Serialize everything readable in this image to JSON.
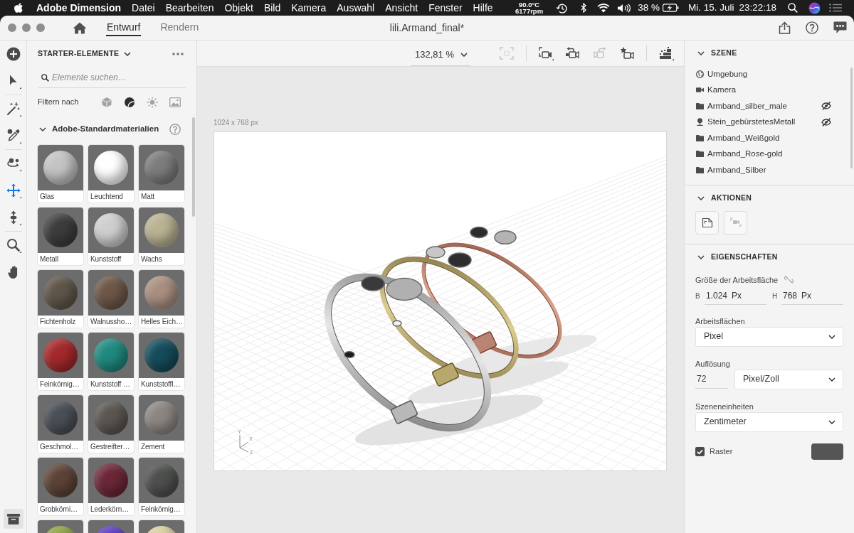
{
  "menubar": {
    "app": "Adobe Dimension",
    "menus": [
      "Datei",
      "Bearbeiten",
      "Objekt",
      "Bild",
      "Kamera",
      "Auswahl",
      "Ansicht",
      "Fenster",
      "Hilfe"
    ],
    "temperature": "90.0°C",
    "fan_speed": "6177rpm",
    "battery": "38 %",
    "date": "Mi. 15. Juli",
    "time": "23:22:18"
  },
  "titlebar": {
    "tabs": [
      {
        "label": "Entwurf",
        "selected": true
      },
      {
        "label": "Rendern",
        "selected": false
      }
    ],
    "title": "lili.Armand_final*"
  },
  "tool_groups": [
    [
      {
        "kind": "select",
        "selected": false
      }
    ],
    [
      {
        "kind": "magic-wand",
        "selected": false
      },
      {
        "kind": "eyedropper",
        "selected": false
      }
    ],
    [
      {
        "kind": "orbit",
        "selected": false
      },
      {
        "kind": "pan",
        "selected": true
      },
      {
        "kind": "dolly",
        "selected": false
      }
    ],
    [
      {
        "kind": "zoom",
        "selected": false
      },
      {
        "kind": "hand",
        "selected": false
      }
    ]
  ],
  "assets_panel": {
    "title": "STARTER-ELEMENTE",
    "search": {
      "placeholder": "Elemente suchen…"
    },
    "filter_label": "Filtern nach",
    "filters": [
      {
        "kind": "models",
        "selected": false
      },
      {
        "kind": "materials",
        "selected": true
      },
      {
        "kind": "lights",
        "selected": false
      },
      {
        "kind": "images",
        "selected": false
      }
    ],
    "section": {
      "title": "Adobe-Standardmaterialien",
      "expanded": true
    },
    "materials": [
      {
        "label": "Glas",
        "color": "#c4c4c4"
      },
      {
        "label": "Leuchtend",
        "color": "#ffffff"
      },
      {
        "label": "Matt",
        "color": "#7c7c7c"
      },
      {
        "label": "Metall",
        "color": "#3c3c3c"
      },
      {
        "label": "Kunststoff",
        "color": "#cfcfcf"
      },
      {
        "label": "Wachs",
        "color": "#b9b293"
      },
      {
        "label": "Fichtenholz",
        "color": "#5f5649"
      },
      {
        "label": "Walnussho…",
        "color": "#6d5747"
      },
      {
        "label": "Helles Eich…",
        "color": "#a98f80"
      },
      {
        "label": "Feinkörnig…",
        "color": "#a3292b"
      },
      {
        "label": "Kunststoff …",
        "color": "#1f8a7f"
      },
      {
        "label": "Kunststoffl…",
        "color": "#154c5c"
      },
      {
        "label": "Geschmol…",
        "color": "#4a4f56"
      },
      {
        "label": "Gestreifter…",
        "color": "#5b5651"
      },
      {
        "label": "Zement",
        "color": "#8b8681"
      },
      {
        "label": "Grobkörni…",
        "color": "#5c4337"
      },
      {
        "label": "Lederkörn…",
        "color": "#6b2737"
      },
      {
        "label": "Feinkörnig…",
        "color": "#4e504e"
      },
      {
        "color": "#8ea243"
      },
      {
        "color": "#5b3cc2"
      },
      {
        "color": "#d9d1a2"
      }
    ]
  },
  "viewport": {
    "zoom": "132,81 %",
    "tool_groups": [
      [
        {
          "kind": "fit",
          "disabled": true
        }
      ],
      [
        {
          "kind": "camera-frame",
          "disabled": false
        },
        {
          "kind": "camera-undo",
          "disabled": false
        },
        {
          "kind": "camera-redo",
          "disabled": true
        },
        {
          "kind": "camera-bookmark",
          "disabled": false
        }
      ],
      [
        {
          "kind": "render-preview",
          "disabled": false
        }
      ]
    ],
    "canvas_size": "1024 x 768 px",
    "axis_labels": {
      "y": "Y",
      "x": "X",
      "z": "Z"
    }
  },
  "scene_panel": {
    "title": "SZENE",
    "expanded": true,
    "items": [
      {
        "label": "Umgebung",
        "kind": "environment",
        "hidden": false
      },
      {
        "label": "Kamera",
        "kind": "camera",
        "hidden": false
      },
      {
        "label": "Armband_silber_male",
        "kind": "group",
        "hidden": true
      },
      {
        "label": "Stein_gebürstetesMetall",
        "kind": "model",
        "hidden": true
      },
      {
        "label": "Armband_Weißgold",
        "kind": "group",
        "hidden": false
      },
      {
        "label": "Armband_Rose-gold",
        "kind": "group",
        "hidden": false
      },
      {
        "label": "Armband_Silber",
        "kind": "group",
        "hidden": false
      }
    ]
  },
  "actions_panel": {
    "title": "AKTIONEN",
    "expanded": true,
    "buttons": [
      {
        "kind": "fit-artboard",
        "disabled": false
      },
      {
        "kind": "frame-camera",
        "disabled": true
      }
    ]
  },
  "properties_panel": {
    "title": "EIGENSCHAFTEN",
    "expanded": true,
    "size_label": "Größe der Arbeitsfläche",
    "width": {
      "prefix": "B",
      "value": "1.024",
      "unit": "Px"
    },
    "height": {
      "prefix": "H",
      "value": "768",
      "unit": "Px"
    },
    "artboard_label": "Arbeitsflächen",
    "artboard_unit": "Pixel",
    "resolution_label": "Auflösung",
    "resolution": "72",
    "resolution_unit": "Pixel/Zoll",
    "scene_units_label": "Szeneneinheiten",
    "scene_units": "Zentimeter",
    "grid": {
      "label": "Raster",
      "checked": true,
      "color": "#555555"
    }
  }
}
